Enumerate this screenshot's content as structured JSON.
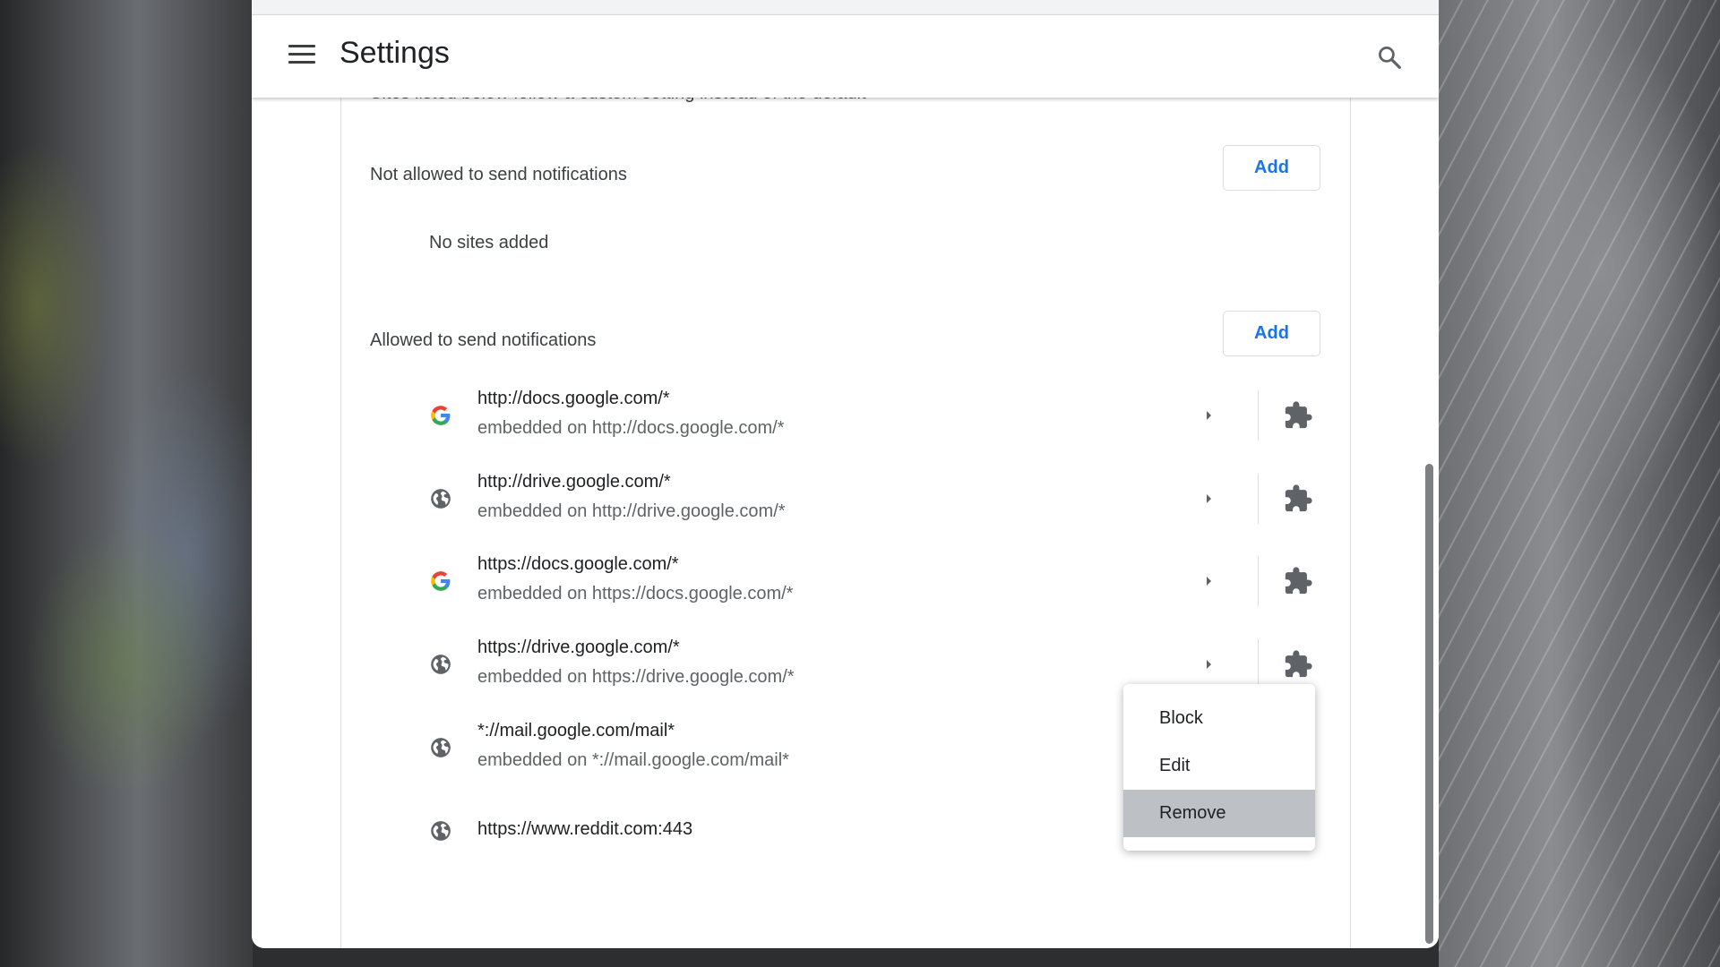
{
  "header": {
    "title": "Settings"
  },
  "section_intro": "Sites listed below follow a custom setting instead of the default",
  "blocked": {
    "title": "Not allowed to send notifications",
    "add_label": "Add",
    "empty_text": "No sites added"
  },
  "allowed": {
    "title": "Allowed to send notifications",
    "add_label": "Add",
    "sites": [
      {
        "url": "http://docs.google.com/*",
        "embedded": "embedded on http://docs.google.com/*",
        "icon": "google-icon"
      },
      {
        "url": "http://drive.google.com/*",
        "embedded": "embedded on http://drive.google.com/*",
        "icon": "globe-icon"
      },
      {
        "url": "https://docs.google.com/*",
        "embedded": "embedded on https://docs.google.com/*",
        "icon": "google-icon"
      },
      {
        "url": "https://drive.google.com/*",
        "embedded": "embedded on https://drive.google.com/*",
        "icon": "globe-icon"
      },
      {
        "url": "*://mail.google.com/mail*",
        "embedded": "embedded on *://mail.google.com/mail*",
        "icon": "globe-icon"
      },
      {
        "url": "https://www.reddit.com:443",
        "embedded": "",
        "icon": "globe-icon"
      }
    ]
  },
  "context_menu": {
    "items": [
      "Block",
      "Edit",
      "Remove"
    ],
    "highlighted": "Remove"
  },
  "colors": {
    "accent": "#1a73e8",
    "highlight": "#bdc1c6"
  }
}
